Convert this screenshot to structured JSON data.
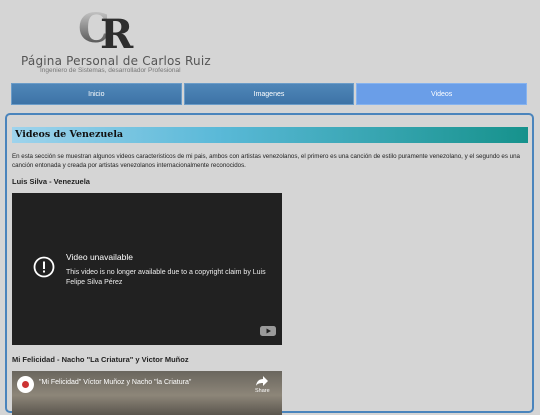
{
  "header": {
    "logo_letters": "CR",
    "title": "Página Personal de Carlos Ruiz",
    "subtitle": "Ingeniero de Sistemas, desarrollador Profesional"
  },
  "nav": {
    "items": [
      {
        "label": "Inicio",
        "active": false
      },
      {
        "label": "Imagenes",
        "active": false
      },
      {
        "label": "Videos",
        "active": true
      }
    ]
  },
  "main": {
    "section_title": "Videos de Venezuela",
    "intro": "En esta sección se muestran algunos videos caracteristicos de mi pais, ambos con artistas venezolanos, el primero es una canción de estilo puramente venezolano, y el segundo es una canción entonada y creada por artistas venezolanos internacionalmente reconocidos.",
    "videos": [
      {
        "heading": "Luis Silva - Venezuela",
        "player_title": "Video unavailable",
        "player_message": "This video is no longer available due to a copyright claim by Luis Felipe Silva Pérez"
      },
      {
        "heading": "Mi Felicidad - Nacho \"La Criatura\" y Victor Muñoz",
        "player_title": "\"Mi Felicidad\" Víctor Muñoz y Nacho \"la Criatura\"",
        "share_label": "Share"
      }
    ]
  },
  "colors": {
    "nav": "#3d73a6",
    "nav_active": "#6a9ee8",
    "border": "#4a84bc",
    "title_gradient_end": "#16928c"
  }
}
